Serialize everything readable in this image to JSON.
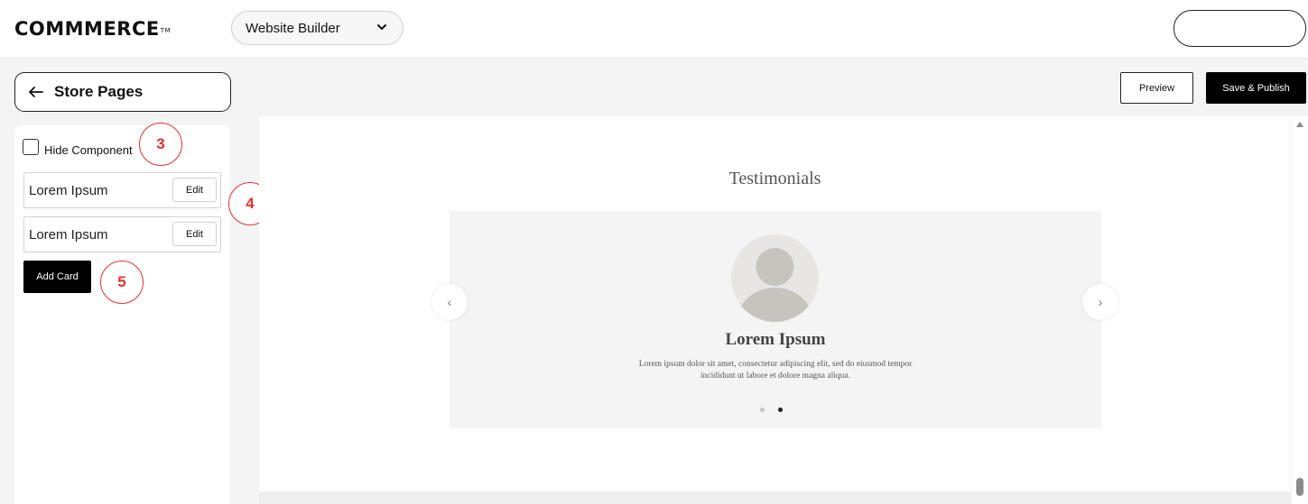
{
  "header": {
    "logo_text": "COMMMERCE",
    "logo_tm": "TM",
    "builder_dropdown": {
      "selected": "Website Builder",
      "icon": "chevron-down-icon"
    },
    "profile_button_label": ""
  },
  "toolbar": {
    "store_pages_label": "Store Pages",
    "back_icon": "arrow-left-icon",
    "preview_label": "Preview",
    "publish_label": "Save & Publish"
  },
  "panel": {
    "hide_component_label": "Hide Component",
    "hide_component_checked": false,
    "cards": [
      {
        "label": "Lorem Ipsum",
        "edit_label": "Edit"
      },
      {
        "label": "Lorem Ipsum",
        "edit_label": "Edit"
      }
    ],
    "add_card_label": "Add Card"
  },
  "callouts": [
    "3",
    "4",
    "5"
  ],
  "preview": {
    "section_title": "Testimonials",
    "testimonial": {
      "name": "Lorem Ipsum",
      "quote": "Lorem ipsum dolor sit amet, consectetur adipiscing elit, sed do eiusmod tempor incididunt ut labore et dolore magna aliqua."
    },
    "prev_arrow": "‹",
    "next_arrow": "›",
    "pagination": {
      "total": 2,
      "active_index": 1
    }
  },
  "colors": {
    "callout": "#dd3333",
    "primary_button": "#000000",
    "canvas_background": "#ffffff",
    "carousel_background": "#f4f4f4"
  }
}
